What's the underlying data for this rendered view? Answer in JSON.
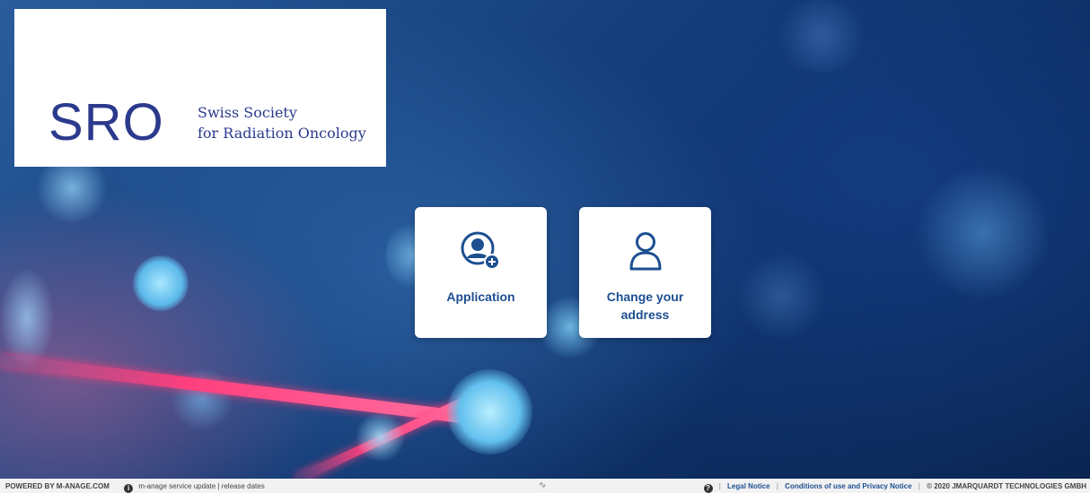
{
  "logo": {
    "abbr": "SRO",
    "line1": "Swiss Society",
    "line2": "for Radiation Oncology"
  },
  "cards": {
    "application": {
      "label": "Application",
      "icon": "user-add-icon"
    },
    "change_address": {
      "label": "Change your address",
      "icon": "user-icon"
    }
  },
  "footer": {
    "powered_by": "POWERED BY M-ANAGE.COM",
    "info_icon": "i",
    "service_update": "m-anage service update | release dates",
    "mid_mark": "∿",
    "help_icon": "?",
    "legal_notice": "Legal Notice",
    "conditions": "Conditions of use and Privacy Notice",
    "copyright": "© 2020 JMARQUARDT TECHNOLOGIES GMBH"
  },
  "colors": {
    "brand_blue": "#2b3a8c",
    "accent_blue": "#1d4f91",
    "beam_pink": "#ff3f7e"
  }
}
